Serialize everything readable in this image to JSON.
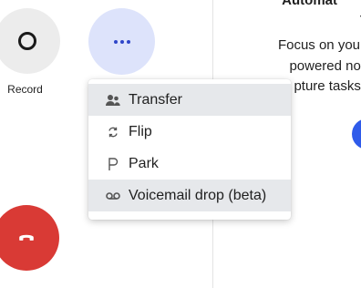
{
  "controls": {
    "record_label": "Record"
  },
  "menu": {
    "items": [
      {
        "label": "Transfer",
        "icon": "transfer-icon",
        "active": true
      },
      {
        "label": "Flip",
        "icon": "flip-icon",
        "active": false
      },
      {
        "label": "Park",
        "icon": "park-icon",
        "active": false
      },
      {
        "label": "Voicemail drop (beta)",
        "icon": "voicemail-icon",
        "active": true
      }
    ]
  },
  "promo": {
    "title_line1": "Automat",
    "title_line2": "t",
    "body_line1": "Focus on your",
    "body_line2": "powered not",
    "body_line3": "pture tasks,"
  },
  "colors": {
    "hangup": "#d93a35",
    "accent": "#2f46c9",
    "more_bg": "#dde3fb"
  }
}
